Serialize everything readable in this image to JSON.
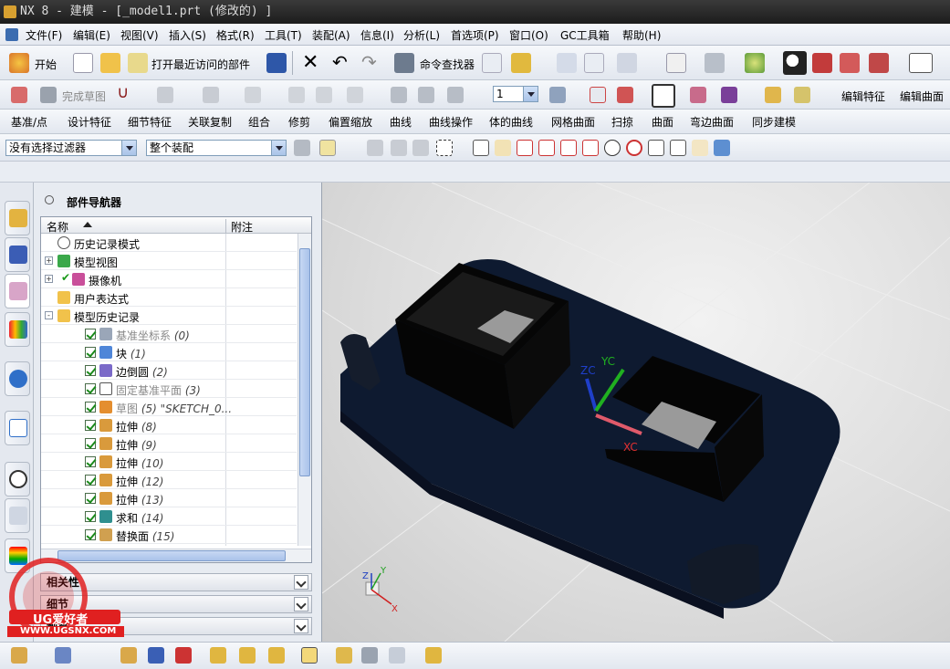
{
  "window": {
    "title": "NX 8 - 建模 - [_model1.prt  (修改的) ]"
  },
  "menu": [
    "文件(F)",
    "编辑(E)",
    "视图(V)",
    "插入(S)",
    "格式(R)",
    "工具(T)",
    "装配(A)",
    "信息(I)",
    "分析(L)",
    "首选项(P)",
    "窗口(O)",
    "GC工具箱",
    "帮助(H)"
  ],
  "toolbar1": {
    "start_label": "开始",
    "recent_label": "打开最近访问的部件",
    "finder_label": "命令查找器"
  },
  "toolbar2": {
    "finish_sketch_label": "完成草图",
    "layer_value": "1",
    "edit_feature_label": "编辑特征",
    "edit_surface_label": "编辑曲面"
  },
  "ribbon": [
    "基准/点",
    "设计特征",
    "细节特征",
    "关联复制",
    "组合",
    "修剪",
    "偏置缩放",
    "曲线",
    "曲线操作",
    "体的曲线",
    "网格曲面",
    "扫掠",
    "曲面",
    "弯边曲面",
    "同步建模"
  ],
  "selection": {
    "filter_value": "没有选择过滤器",
    "scope_value": "整个装配"
  },
  "navigator": {
    "title": "部件导航器",
    "col_name": "名称",
    "col_note": "附注",
    "rows": [
      {
        "label": "历史记录模式",
        "num": "",
        "level": 0,
        "icon": "clock",
        "expander": "",
        "checked": false,
        "dim": false
      },
      {
        "label": "模型视图",
        "num": "",
        "level": 0,
        "icon": "cube-view",
        "expander": "+",
        "checked": false,
        "dim": false
      },
      {
        "label": "摄像机",
        "num": "",
        "level": 0,
        "icon": "camera",
        "expander": "+",
        "checked": false,
        "dim": false,
        "tick": true
      },
      {
        "label": "用户表达式",
        "num": "",
        "level": 0,
        "icon": "folder",
        "expander": "",
        "checked": false,
        "dim": false
      },
      {
        "label": "模型历史记录",
        "num": "",
        "level": 0,
        "icon": "folder-open",
        "expander": "-",
        "checked": false,
        "dim": false
      },
      {
        "label": "基准坐标系",
        "num": "(0)",
        "level": 1,
        "icon": "datum-csys",
        "expander": "",
        "checked": true,
        "dim": true
      },
      {
        "label": "块",
        "num": "(1)",
        "level": 1,
        "icon": "block",
        "expander": "",
        "checked": true,
        "dim": false
      },
      {
        "label": "边倒圆",
        "num": "(2)",
        "level": 1,
        "icon": "edge-blend",
        "expander": "",
        "checked": true,
        "dim": false
      },
      {
        "label": "固定基准平面",
        "num": "(3)",
        "level": 1,
        "icon": "datum-plane",
        "expander": "",
        "checked": true,
        "dim": true
      },
      {
        "label": "草图",
        "num": "(5) \"SKETCH_0...",
        "level": 1,
        "icon": "sketch",
        "expander": "",
        "checked": true,
        "dim": true
      },
      {
        "label": "拉伸",
        "num": "(8)",
        "level": 1,
        "icon": "extrude",
        "expander": "",
        "checked": true,
        "dim": false
      },
      {
        "label": "拉伸",
        "num": "(9)",
        "level": 1,
        "icon": "extrude",
        "expander": "",
        "checked": true,
        "dim": false
      },
      {
        "label": "拉伸",
        "num": "(10)",
        "level": 1,
        "icon": "extrude",
        "expander": "",
        "checked": true,
        "dim": false
      },
      {
        "label": "拉伸",
        "num": "(12)",
        "level": 1,
        "icon": "extrude",
        "expander": "",
        "checked": true,
        "dim": false
      },
      {
        "label": "拉伸",
        "num": "(13)",
        "level": 1,
        "icon": "extrude",
        "expander": "",
        "checked": true,
        "dim": false
      },
      {
        "label": "求和",
        "num": "(14)",
        "level": 1,
        "icon": "unite",
        "expander": "",
        "checked": true,
        "dim": false
      },
      {
        "label": "替换面",
        "num": "(15)",
        "level": 1,
        "icon": "replace-face",
        "expander": "",
        "checked": true,
        "dim": false
      }
    ],
    "panels": [
      "相关性",
      "细节",
      "预览"
    ]
  },
  "viewport": {
    "axis_xc": "XC",
    "axis_yc": "YC",
    "axis_zc": "ZC",
    "triad_x": "X",
    "triad_y": "Y",
    "triad_z": "Z"
  },
  "watermark": {
    "brand": "UG爱好者",
    "url": "WWW.UGSNX.COM"
  }
}
